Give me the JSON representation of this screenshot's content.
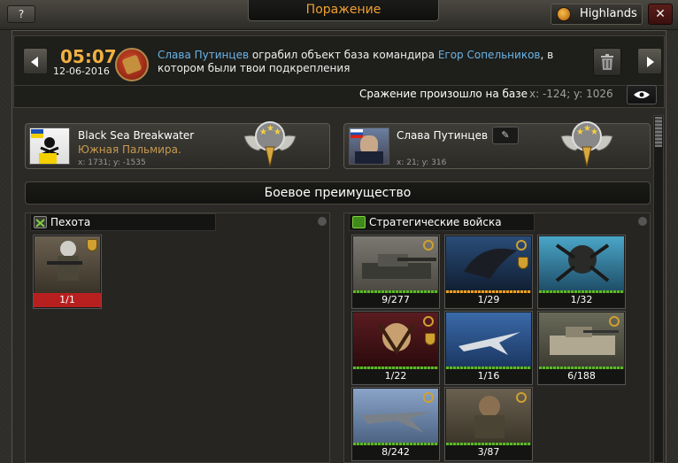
{
  "topbar": {
    "help_label": "?",
    "title": "Поражение",
    "server_name": "Highlands",
    "close_label": "✕"
  },
  "header": {
    "time": "05:07",
    "date": "12-06-2016",
    "message": {
      "attacker": "Слава Путинцев",
      "text1": " ограбил объект база командира ",
      "commander": "Егор Сопельников",
      "text2": ", в котором были твои подкрепления"
    },
    "battle_text": "Сражение произошло на базе",
    "coords": "x: -124; y: 1026"
  },
  "players": [
    {
      "name": "Black Sea Breakwater",
      "city": "Южная Пальмира.",
      "coords": "x: 1731; y: -1535"
    },
    {
      "name": "Слава Путинцев",
      "city": "",
      "coords": "x: 21; y: 316"
    }
  ],
  "advantage_title": "Боевое преимущество",
  "panels": {
    "left": {
      "title": "Пехота",
      "units": [
        {
          "count": "1/1",
          "icon": "soldier-icon",
          "status": "red"
        }
      ]
    },
    "right": {
      "title": "Стратегические войска",
      "units": [
        {
          "count": "9/277",
          "icon": "tank-icon"
        },
        {
          "count": "1/29",
          "icon": "alien-icon"
        },
        {
          "count": "1/32",
          "icon": "beast-icon"
        },
        {
          "count": "1/22",
          "icon": "predator-icon"
        },
        {
          "count": "1/16",
          "icon": "jet-icon"
        },
        {
          "count": "6/188",
          "icon": "ifv-icon"
        },
        {
          "count": "8/242",
          "icon": "aircraft-icon"
        },
        {
          "count": "3/87",
          "icon": "commando-icon"
        }
      ]
    }
  }
}
